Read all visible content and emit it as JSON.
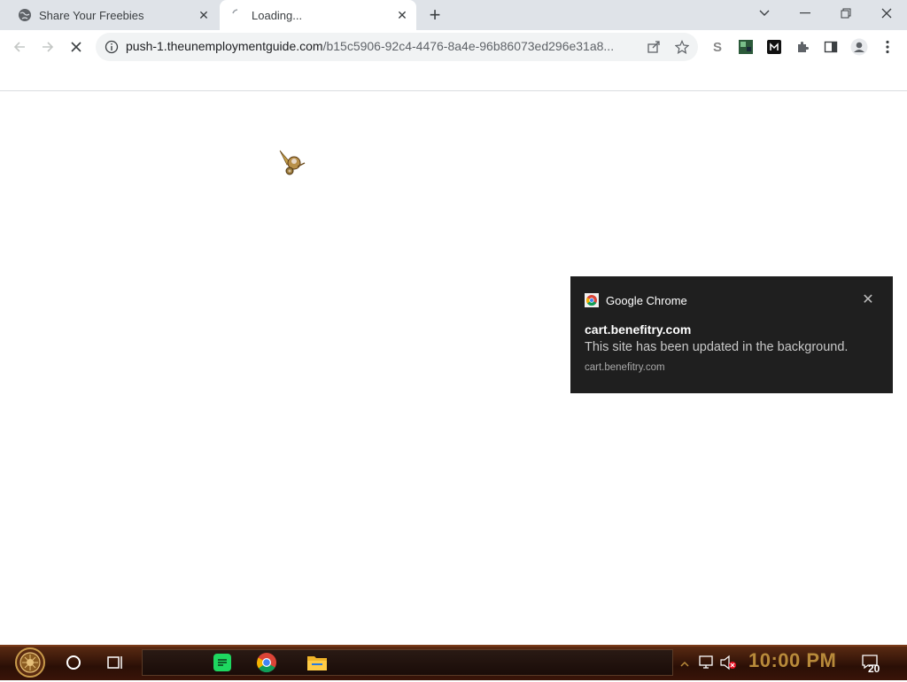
{
  "browser": {
    "tabs": [
      {
        "title": "Share Your Freebies",
        "active": false,
        "icon": "globe-icon"
      },
      {
        "title": "Loading...",
        "active": true,
        "icon": "loading-icon"
      }
    ],
    "address_bar": {
      "url_host": "push-1.theunemploymentguide.com",
      "url_rest": "/b15c5906-92c4-4476-8a4e-96b86073ed296e31a8..."
    },
    "colors": {
      "tab_strip": "#dfe3e8",
      "omnibox": "#f1f3f4"
    }
  },
  "notification": {
    "app": "Google Chrome",
    "title": "cart.benefitry.com",
    "body": "This site has been updated in the background.",
    "source": "cart.benefitry.com",
    "background": "#1f1f1f"
  },
  "taskbar": {
    "clock": "10:00 PM",
    "notification_count": "20",
    "pinned": [
      "spotify-icon",
      "chrome-icon",
      "file-explorer-icon"
    ]
  }
}
